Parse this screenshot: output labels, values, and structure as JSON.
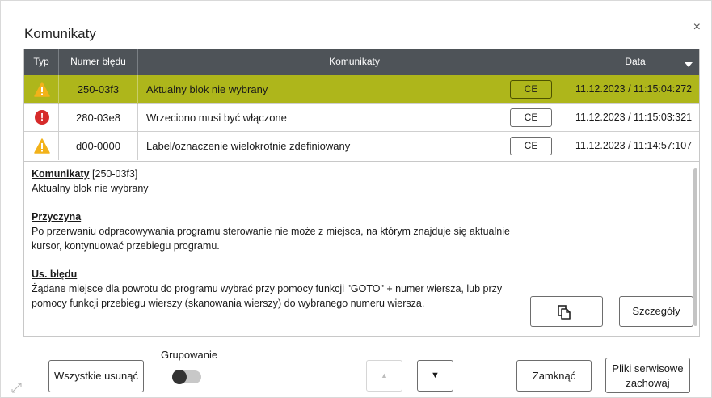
{
  "dialog": {
    "title": "Komunikaty",
    "close_glyph": "×"
  },
  "table": {
    "headers": {
      "type": "Typ",
      "number": "Numer błędu",
      "message": "Komunikaty",
      "date": "Data"
    },
    "rows": [
      {
        "icon": "warning-icon",
        "number": "250-03f3",
        "message": "Aktualny blok nie wybrany",
        "ce": "CE",
        "date": "11.12.2023 / 11:15:04:272",
        "selected": true
      },
      {
        "icon": "error-icon",
        "number": "280-03e8",
        "message": "Wrzeciono musi być włączone",
        "ce": "CE",
        "date": "11.12.2023 / 11:15:03:321",
        "selected": false
      },
      {
        "icon": "warning-icon",
        "number": "d00-0000",
        "message": "Label/oznaczenie wielokrotnie zdefiniowany",
        "ce": "CE",
        "date": "11.12.2023 / 11:14:57:107",
        "selected": false
      }
    ]
  },
  "details": {
    "head_title": "Komunikaty",
    "head_code": " [250-03f3]",
    "summary": "Aktualny blok nie wybrany",
    "cause_title": "Przyczyna",
    "cause_line1": "Po przerwaniu odpracowywania programu sterowanie nie może z miejsca, na którym znajduje się aktualnie",
    "cause_line2": "kursor, kontynuować przebiegu programu.",
    "fix_title": "Us. błędu",
    "fix_line1": "Żądane miejsce dla powrotu do programu wybrać przy pomocy funkcji \"GOTO\" + numer wiersza, lub przy",
    "fix_line2": "pomocy funkcji przebiegu wierszy (skanowania wierszy) do wybranego numeru wiersza.",
    "details_button": "Szczegóły"
  },
  "footer": {
    "delete_all": "Wszystkie usunąć",
    "grouping_label": "Grupowanie",
    "grouping_on": false,
    "up_glyph": "▲",
    "down_glyph": "▼",
    "close_button": "Zamknąć",
    "save_service_line1": "Pliki serwisowe",
    "save_service_line2": "zachowaj"
  },
  "colors": {
    "header_bg": "#4e5358",
    "selected_row": "#aeb61b",
    "warning": "#f2b21a",
    "error": "#d62b2b"
  }
}
